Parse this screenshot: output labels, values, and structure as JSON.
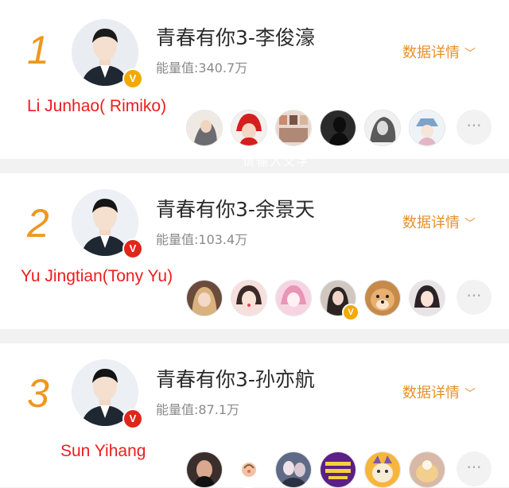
{
  "cards": [
    {
      "rank": "1",
      "title": "青春有你3-李俊濠",
      "energy": "能量值:340.7万",
      "detail_label": "数据详情",
      "caption": "Li Junhao( Rimiko)",
      "verify_badge": "V",
      "verify_color": "#f2a900"
    },
    {
      "rank": "2",
      "title": "青春有你3-余景天",
      "energy": "能量值:103.4万",
      "detail_label": "数据详情",
      "caption": "Yu Jingtian(Tony Yu)",
      "verify_badge": "V",
      "verify_color": "#e0261a"
    },
    {
      "rank": "3",
      "title": "青春有你3-孙亦航",
      "energy": "能量值:87.1万",
      "detail_label": "数据详情",
      "caption": "Sun Yihang",
      "verify_badge": "V",
      "verify_color": "#e0261a"
    }
  ],
  "more_label": "···",
  "fan_verify_badge": "V",
  "watermark": "请输入文字",
  "colors": {
    "rank": "#f0961e",
    "detail": "#e6902c",
    "caption": "#ee1c1c"
  }
}
